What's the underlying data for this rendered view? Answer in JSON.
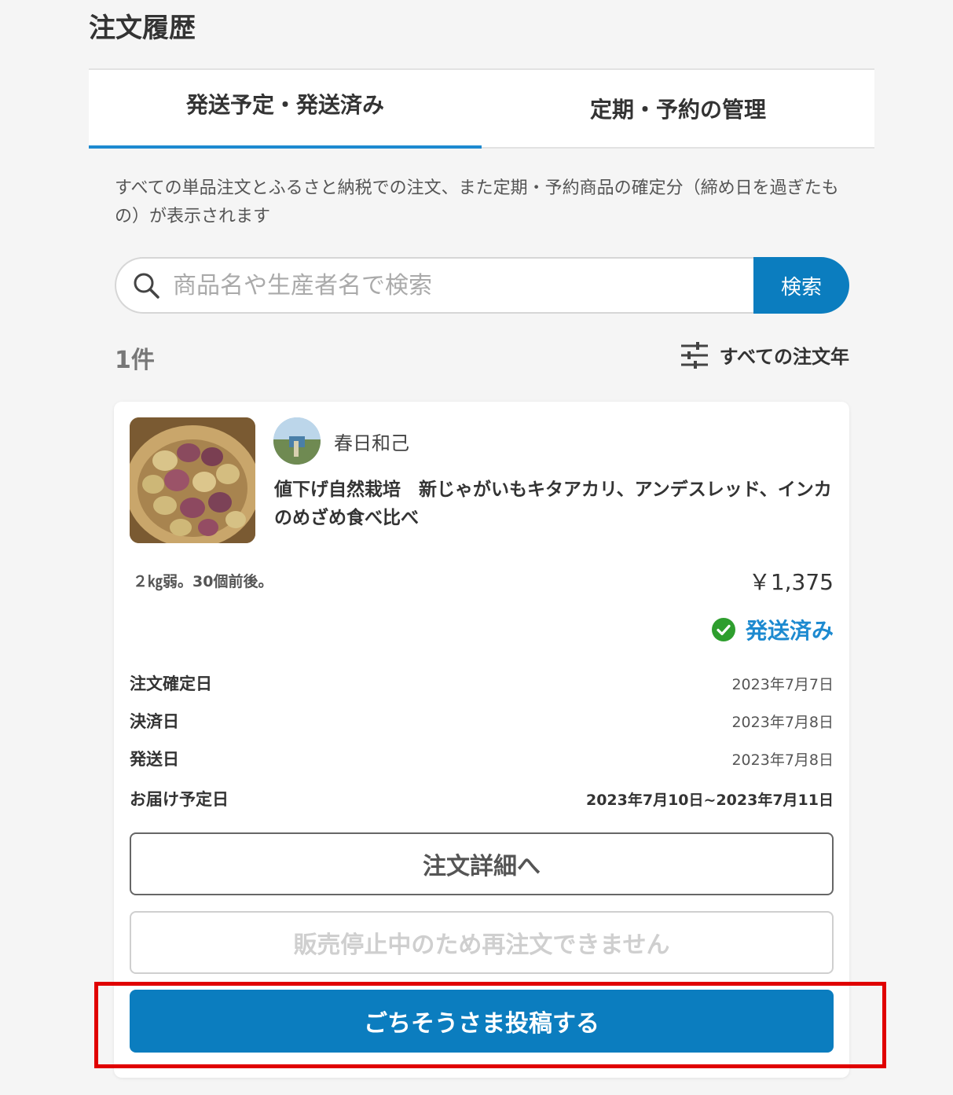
{
  "page_title": "注文履歴",
  "tabs": [
    {
      "label": "発送予定・発送済み",
      "active": true
    },
    {
      "label": "定期・予約の管理",
      "active": false
    }
  ],
  "notice": "すべての単品注文とふるさと納税での注文、また定期・予約商品の確定分（締め日を過ぎたもの）が表示されます",
  "search": {
    "placeholder": "商品名や生産者名で検索",
    "button_label": "検索"
  },
  "result_count": "1件",
  "year_filter_label": "すべての注文年",
  "order": {
    "producer_name": "春日和己",
    "product_name": "値下げ自然栽培　新じゃがいもキタアカリ、アンデスレッド、インカのめざめ食べ比べ",
    "variant": "２㎏弱。30個前後。",
    "price": "￥1,375",
    "status": "発送済み",
    "dates": [
      {
        "label": "注文確定日",
        "value": "2023年7月7日"
      },
      {
        "label": "決済日",
        "value": "2023年7月8日"
      },
      {
        "label": "発送日",
        "value": "2023年7月8日"
      },
      {
        "label": "お届け予定日",
        "value": "2023年7月10日~2023年7月11日"
      }
    ],
    "detail_button": "注文詳細へ",
    "reorder_button": "販売停止中のため再注文できません",
    "post_button": "ごちそうさま投稿する"
  },
  "colors": {
    "accent": "#0b7dbf",
    "tab_indicator": "#1d8ad0",
    "status_check": "#2e9e2e",
    "highlight": "#e00000"
  }
}
